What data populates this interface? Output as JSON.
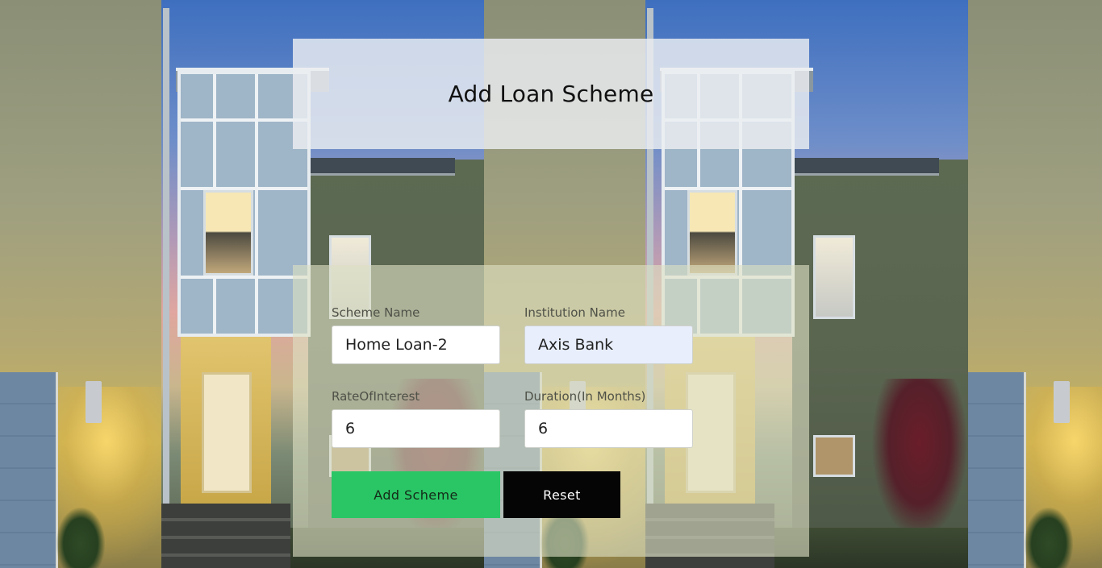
{
  "page": {
    "title": "Add Loan Scheme"
  },
  "form": {
    "scheme_name": {
      "label": "Scheme Name",
      "value": "Home Loan-2"
    },
    "institution_name": {
      "label": "Institution Name",
      "value": "Axis Bank"
    },
    "rate_of_interest": {
      "label": "RateOfInterest",
      "value": "6"
    },
    "duration": {
      "label": "Duration(In Months)",
      "value": "6"
    }
  },
  "buttons": {
    "add_label": "Add Scheme",
    "reset_label": "Reset"
  },
  "colors": {
    "add_button": "#2ac665",
    "reset_button": "#050505",
    "autofill_field": "#e8eefc"
  }
}
